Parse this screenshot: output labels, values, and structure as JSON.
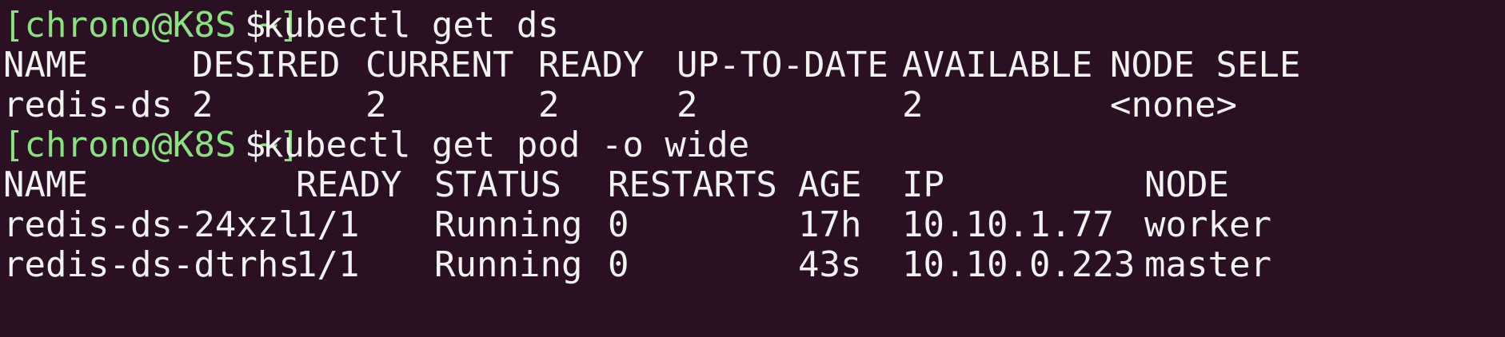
{
  "terminal": {
    "colors": {
      "background": "#2b0f22",
      "prompt": "#89e27f",
      "text": "#f2f2f2"
    },
    "prompt": "[chrono@K8S ~]",
    "dollar": "$",
    "commands": [
      "kubectl get ds",
      "kubectl get pod -o wide"
    ],
    "ds_table": {
      "headers": [
        "NAME",
        "DESIRED",
        "CURRENT",
        "READY",
        "UP-TO-DATE",
        "AVAILABLE",
        "NODE SELE"
      ],
      "rows": [
        [
          "redis-ds",
          "2",
          "2",
          "2",
          "2",
          "2",
          "<none>"
        ]
      ]
    },
    "pod_table": {
      "headers": [
        "NAME",
        "READY",
        "STATUS",
        "RESTARTS",
        "AGE",
        "IP",
        "NODE"
      ],
      "rows": [
        [
          "redis-ds-24xzl",
          "1/1",
          "Running",
          "0",
          "17h",
          "10.10.1.77",
          "worker"
        ],
        [
          "redis-ds-dtrhs",
          "1/1",
          "Running",
          "0",
          "43s",
          "10.10.0.223",
          "master"
        ]
      ]
    }
  }
}
